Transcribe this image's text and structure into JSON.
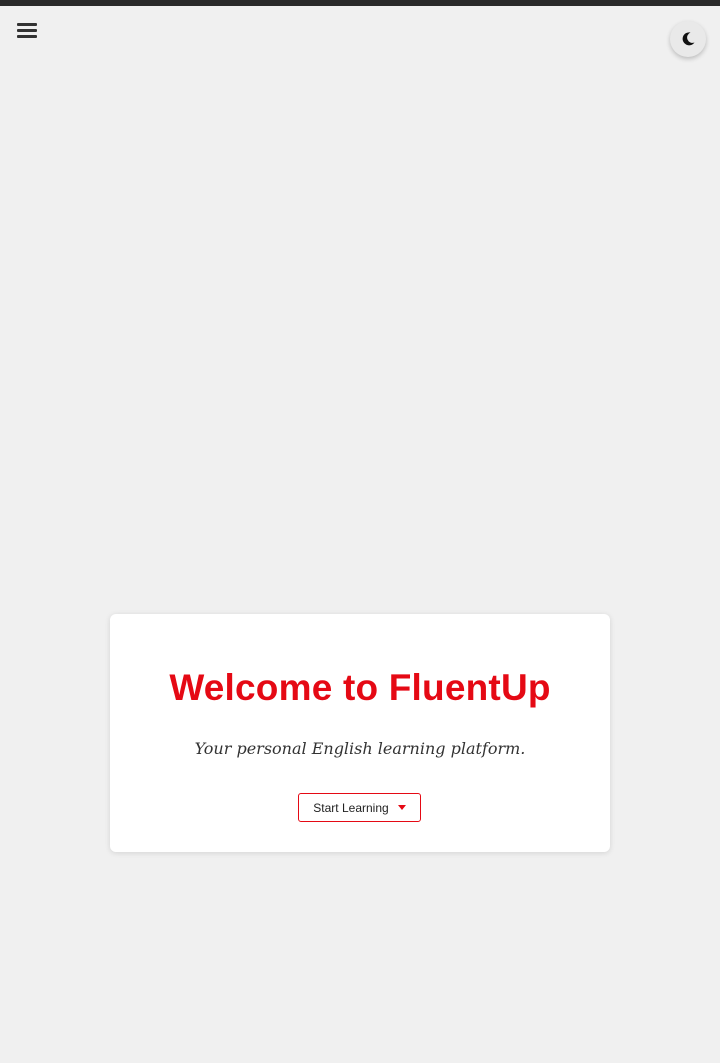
{
  "header": {
    "menu_icon": "hamburger-menu-icon",
    "theme_toggle_icon": "moon-icon"
  },
  "hero": {
    "title": "Welcome to FluentUp",
    "subtitle": "Your personal English learning platform.",
    "cta_label": "Start Learning",
    "cta_icon": "caret-down-icon"
  },
  "colors": {
    "accent": "#e50914",
    "background": "#f0f0f0",
    "card": "#ffffff",
    "top_strip": "#2a2a2a"
  }
}
